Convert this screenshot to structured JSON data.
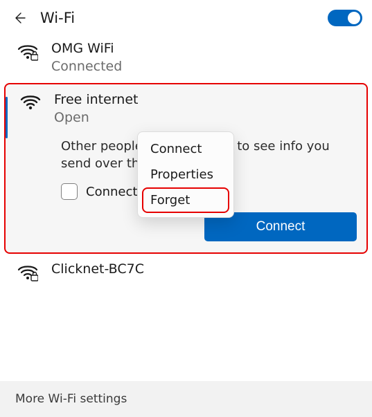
{
  "header": {
    "title": "Wi-Fi",
    "toggle_on": true
  },
  "networks": {
    "item0": {
      "name": "OMG WiFi",
      "status": "Connected",
      "secured": true
    },
    "selected": {
      "name": "Free internet",
      "status": "Open",
      "secured": false,
      "warning": "Other people might be able to see info you send over this network",
      "auto_label": "Connect automatically",
      "connect_btn": "Connect"
    },
    "item2": {
      "name": "Clicknet-BC7C",
      "secured": true
    }
  },
  "context_menu": {
    "connect": "Connect",
    "properties": "Properties",
    "forget": "Forget"
  },
  "footer": {
    "more": "More Wi-Fi settings"
  },
  "colors": {
    "accent": "#0067c0",
    "annotation": "#e60000"
  }
}
